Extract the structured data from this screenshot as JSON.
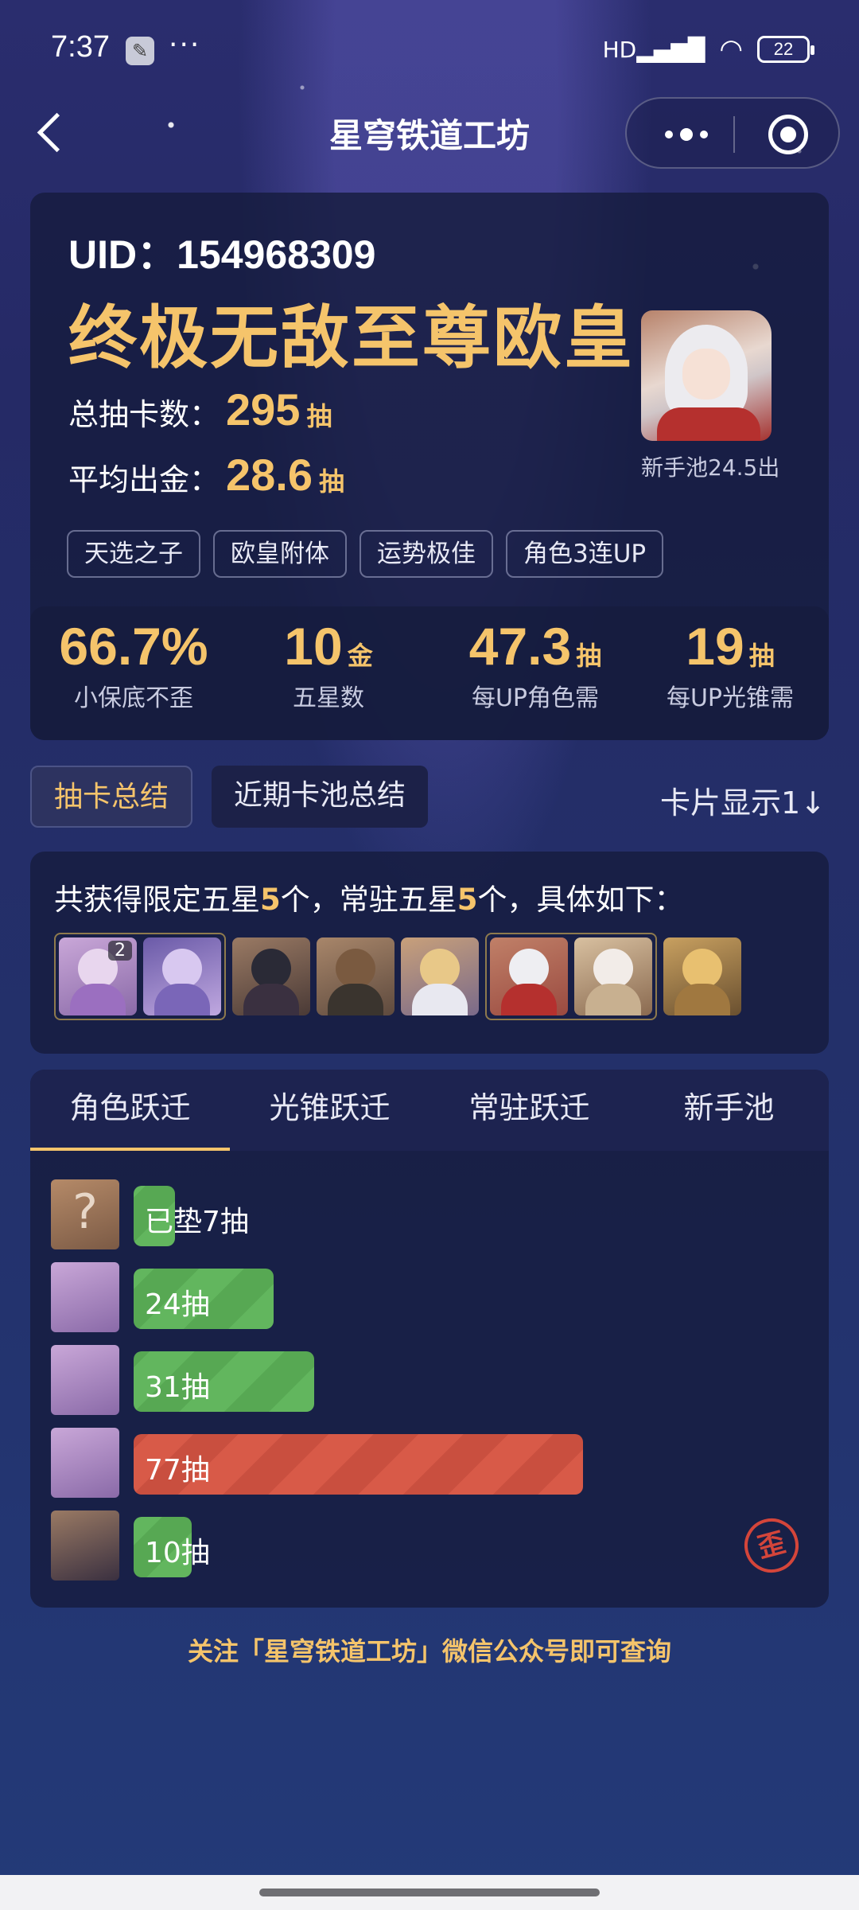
{
  "status": {
    "time": "7:37",
    "signal": "HD",
    "battery": "22"
  },
  "nav": {
    "title": "星穹铁道工坊"
  },
  "profile": {
    "uid": "UID：154968309",
    "rank_title": "终极无敌至尊欧皇",
    "total_pulls_label": "总抽卡数：",
    "total_pulls": "295",
    "unit": "抽",
    "avg_label": "平均出金：",
    "avg_pulls": "28.6",
    "tags": [
      "天选之子",
      "欧皇附体",
      "运势极佳",
      "角色3连UP"
    ],
    "newbie_caption": "新手池24.5出"
  },
  "metrics": [
    {
      "value": "66.7%",
      "unit": "",
      "label": "小保底不歪"
    },
    {
      "value": "10",
      "unit": "金",
      "label": "五星数"
    },
    {
      "value": "47.3",
      "unit": "抽",
      "label": "每UP角色需"
    },
    {
      "value": "19",
      "unit": "抽",
      "label": "每UP光锥需"
    }
  ],
  "tabs": {
    "summary": "抽卡总结",
    "recent": "近期卡池总结",
    "display": "卡片显示1↓"
  },
  "five_star": {
    "prefix": "共获得限定五星",
    "limited": "5",
    "mid": "个，常驻五星",
    "standard": "5",
    "suffix": "个，具体如下：",
    "badge": "2"
  },
  "warp_tabs": [
    "角色跃迁",
    "光锥跃迁",
    "常驻跃迁",
    "新手池"
  ],
  "pulls": [
    {
      "label": "已垫7抽",
      "count": 7,
      "type": "pending"
    },
    {
      "label": "24抽",
      "count": 24,
      "type": "green"
    },
    {
      "label": "31抽",
      "count": 31,
      "type": "green"
    },
    {
      "label": "77抽",
      "count": 77,
      "type": "red"
    },
    {
      "label": "10抽",
      "count": 10,
      "type": "green"
    }
  ],
  "stamp": "歪",
  "footer": "关注「星穹铁道工坊」微信公众号即可查询",
  "colors": {
    "gold": "#f5c46b",
    "green": "#62b65e",
    "red": "#d85a48",
    "panel": "#161c3e"
  }
}
